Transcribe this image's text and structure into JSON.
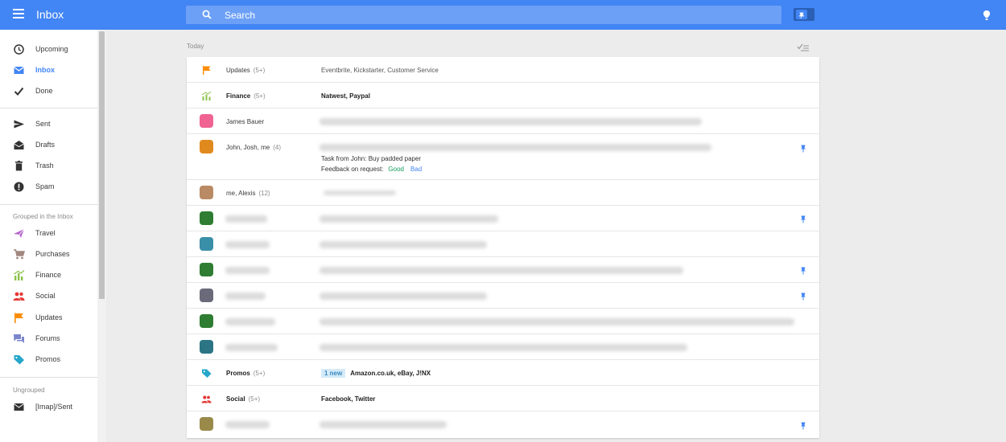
{
  "header": {
    "app_title": "Inbox",
    "search_placeholder": "Search"
  },
  "sidebar": {
    "main_items": [
      {
        "label": "Upcoming",
        "icon": "clock-icon"
      },
      {
        "label": "Inbox",
        "icon": "inbox-icon",
        "active": true
      },
      {
        "label": "Done",
        "icon": "check-icon"
      }
    ],
    "mail_items": [
      {
        "label": "Sent",
        "icon": "send-icon"
      },
      {
        "label": "Drafts",
        "icon": "drafts-icon"
      },
      {
        "label": "Trash",
        "icon": "trash-icon"
      },
      {
        "label": "Spam",
        "icon": "spam-icon"
      }
    ],
    "grouped_heading": "Grouped in the Inbox",
    "grouped_items": [
      {
        "label": "Travel",
        "icon": "plane-icon",
        "color": "#b668cc"
      },
      {
        "label": "Purchases",
        "icon": "cart-icon",
        "color": "#a1887f"
      },
      {
        "label": "Finance",
        "icon": "chart-icon",
        "color": "#8bc34a"
      },
      {
        "label": "Social",
        "icon": "people-icon",
        "color": "#e53935"
      },
      {
        "label": "Updates",
        "icon": "flag-icon",
        "color": "#fb8c00"
      },
      {
        "label": "Forums",
        "icon": "forum-icon",
        "color": "#7986cb"
      },
      {
        "label": "Promos",
        "icon": "tag-icon",
        "color": "#26a7c9"
      }
    ],
    "ungrouped_heading": "Ungrouped",
    "ungrouped_items": [
      {
        "label": "[Imap]/Sent",
        "icon": "folder-mail-icon"
      }
    ]
  },
  "main": {
    "section_label": "Today",
    "rows": [
      {
        "sender": "Updates",
        "count": "(5+)",
        "snippet": "Eventbrite, Kickstarter, Customer Service"
      },
      {
        "sender": "Finance",
        "count": "(5+)",
        "snippet": "Natwest, Paypal"
      },
      {
        "sender": "James Bauer"
      },
      {
        "sender": "John, Josh, me",
        "count": "(4)",
        "task": "Task from John: Buy padded paper",
        "feedback_label": "Feedback on request:",
        "feedback_good": "Good",
        "feedback_bad": "Bad"
      },
      {
        "sender": "me, Alexis",
        "count": "(12)"
      },
      {
        "sender": ""
      },
      {
        "sender": ""
      },
      {
        "sender": ""
      },
      {
        "sender": ""
      },
      {
        "sender": ""
      },
      {
        "sender": ""
      },
      {
        "sender": "Promos",
        "count": "(5+)",
        "badge": "1 new",
        "snippet": "Amazon.co.uk, eBay, J!NX"
      },
      {
        "sender": "Social",
        "count": "(5+)",
        "snippet": "Facebook, Twitter"
      },
      {
        "sender": ""
      }
    ]
  },
  "colors": {
    "accent": "#4285f4",
    "good": "#0f9d58"
  }
}
